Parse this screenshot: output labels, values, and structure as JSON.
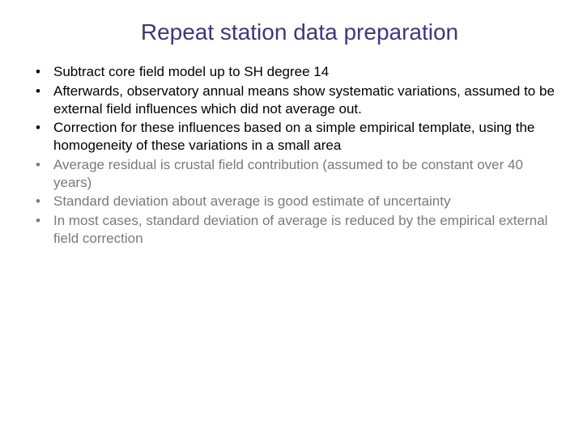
{
  "title": "Repeat station data preparation",
  "bullets": [
    {
      "text": "Subtract core field model up to SH degree 14",
      "dim": false
    },
    {
      "text": "Afterwards, observatory annual means show systematic variations, assumed to be external field influences which did not average out.",
      "dim": false
    },
    {
      "text": "Correction for these influences based on a simple empirical template, using the homogeneity of these variations in a small area",
      "dim": false
    },
    {
      "text": "Average residual is crustal field contribution (assumed to be constant over 40 years)",
      "dim": true
    },
    {
      "text": "Standard deviation about average is good estimate of uncertainty",
      "dim": true
    },
    {
      "text": "In most cases, standard deviation of average is reduced by the empirical external field correction",
      "dim": true
    }
  ]
}
